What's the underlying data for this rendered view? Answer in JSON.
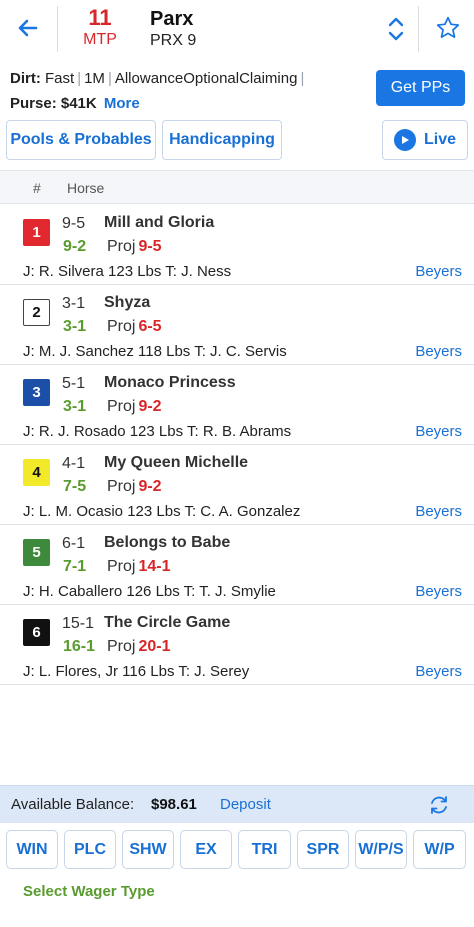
{
  "header": {
    "mtp_number": "11",
    "mtp_label": "MTP",
    "track_name": "Parx",
    "race_code": "PRX 9"
  },
  "race_info": {
    "surface": "Dirt:",
    "condition": "Fast",
    "distance": "1M",
    "race_type": "AllowanceOptionalClaiming",
    "purse_label": "Purse:",
    "purse_value": "$41K",
    "more_label": "More",
    "get_pps_label": "Get PPs"
  },
  "tabs": {
    "pools_label": "Pools & Probables",
    "handicapping_label": "Handicapping",
    "live_label": "Live"
  },
  "table_header": {
    "num": "#",
    "horse": "Horse"
  },
  "horses": [
    {
      "pgm": "1",
      "bg": "#e0282e",
      "fg": "#ffffff",
      "border": "#e0282e",
      "morning_line": "9-5",
      "name": "Mill and Gloria",
      "live_odds": "9-2",
      "proj_label": "Proj",
      "proj": "9-5",
      "connections": "J: R. Silvera 123 Lbs T: J. Ness",
      "beyers": "Beyers"
    },
    {
      "pgm": "2",
      "bg": "#ffffff",
      "fg": "#111111",
      "border": "#444444",
      "morning_line": "3-1",
      "name": "Shyza",
      "live_odds": "3-1",
      "proj_label": "Proj",
      "proj": "6-5",
      "connections": "J: M. J. Sanchez 118 Lbs T: J. C. Servis",
      "beyers": "Beyers"
    },
    {
      "pgm": "3",
      "bg": "#1c4fa8",
      "fg": "#ffffff",
      "border": "#1c4fa8",
      "morning_line": "5-1",
      "name": "Monaco Princess",
      "live_odds": "3-1",
      "proj_label": "Proj",
      "proj": "9-2",
      "connections": "J: R. J. Rosado 123 Lbs T: R. B. Abrams",
      "beyers": "Beyers"
    },
    {
      "pgm": "4",
      "bg": "#f2e92a",
      "fg": "#111111",
      "border": "#f2e92a",
      "morning_line": "4-1",
      "name": "My Queen Michelle",
      "live_odds": "7-5",
      "proj_label": "Proj",
      "proj": "9-2",
      "connections": "J: L. M. Ocasio 123 Lbs T: C. A. Gonzalez",
      "beyers": "Beyers"
    },
    {
      "pgm": "5",
      "bg": "#3e8a3c",
      "fg": "#ffffff",
      "border": "#3e8a3c",
      "morning_line": "6-1",
      "name": "Belongs to Babe",
      "live_odds": "7-1",
      "proj_label": "Proj",
      "proj": "14-1",
      "connections": "J: H. Caballero 126 Lbs T: T. J. Smylie",
      "beyers": "Beyers"
    },
    {
      "pgm": "6",
      "bg": "#111111",
      "fg": "#ffffff",
      "border": "#111111",
      "morning_line": "15-1",
      "name": "The Circle Game",
      "live_odds": "16-1",
      "proj_label": "Proj",
      "proj": "20-1",
      "connections": "J: L. Flores, Jr 116 Lbs T: J. Serey",
      "beyers": "Beyers"
    }
  ],
  "balance": {
    "label": "Available Balance:",
    "value": "$98.61",
    "deposit_label": "Deposit"
  },
  "wager_types": [
    "WIN",
    "PLC",
    "SHW",
    "EX",
    "TRI",
    "SPR",
    "W/P/S",
    "W/P"
  ],
  "select_wager_label": "Select Wager Type",
  "colors": {
    "accent": "#1a76e3",
    "mtp_red": "#d9262a",
    "odds_green": "#5a9b2f"
  }
}
